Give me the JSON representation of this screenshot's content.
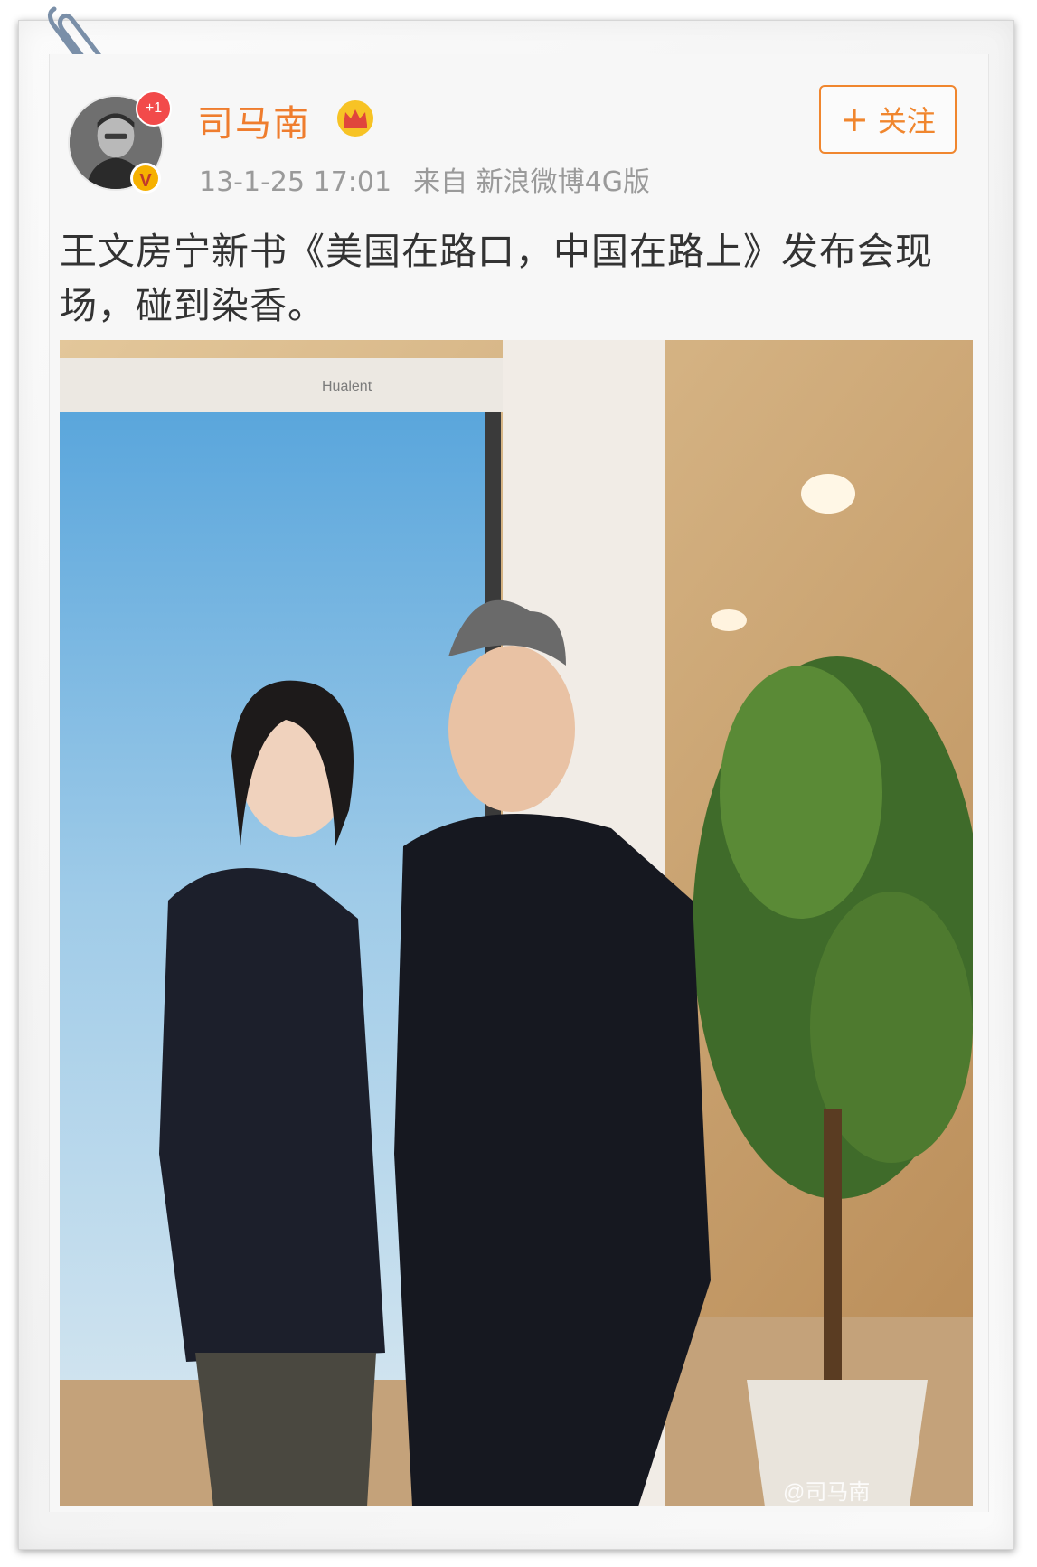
{
  "post": {
    "username": "司马南",
    "plus_badge": "+1",
    "verified_badge": "V",
    "timestamp": "13-1-25 17:01",
    "source": "来自 新浪微博4G版",
    "follow_label": "关注",
    "follow_icon": "plus-icon",
    "text_line1": "王文房宁新书《美国在路口，中国在路上》发布会现",
    "text_line2": "场，碰到染香。",
    "photo_watermark": "@司马南",
    "screen_brand": "Hualent"
  },
  "colors": {
    "username": "#ef7d2e",
    "follow_border": "#f0862e",
    "meta_text": "#9a9a9a",
    "badge_red": "#f24a4a",
    "badge_gold": "#f6b100"
  }
}
